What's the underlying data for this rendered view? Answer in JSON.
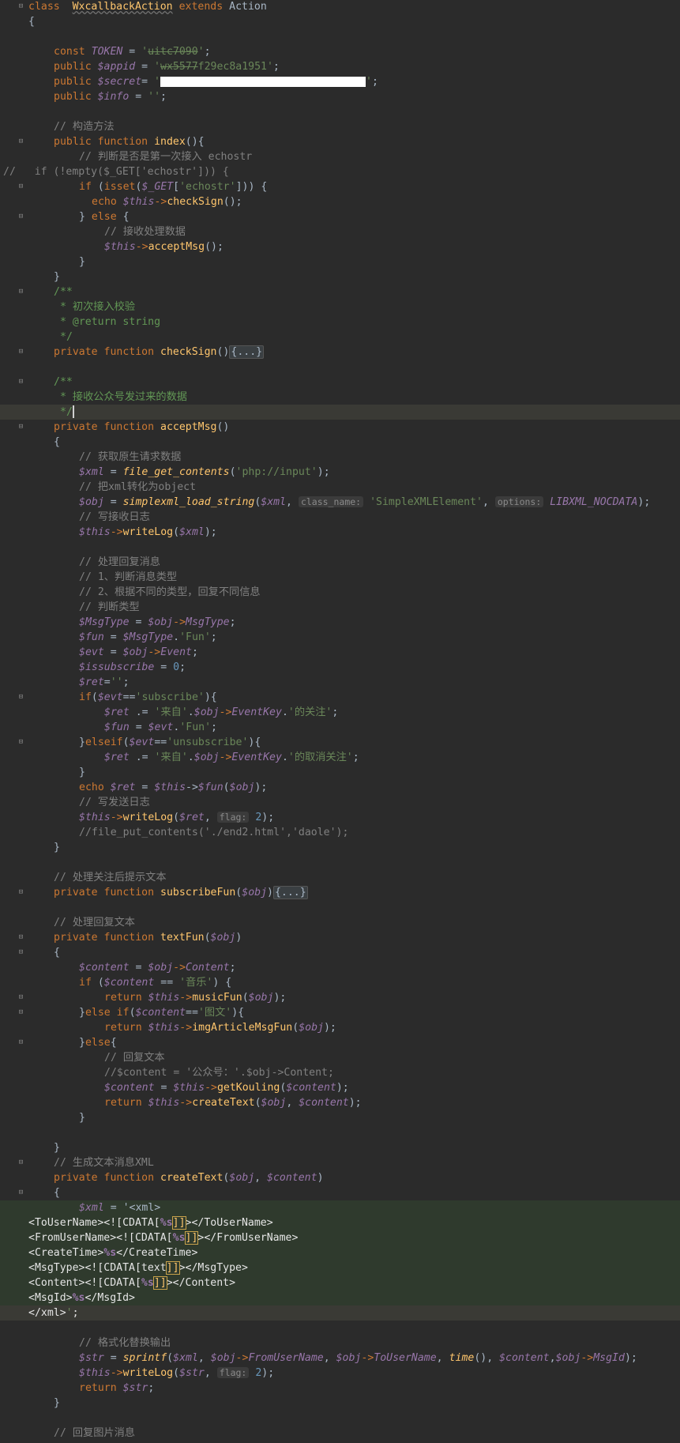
{
  "editor": {
    "lines": [
      "class WxcallbackAction extends Action",
      "{",
      "const TOKEN = 'uitc7090';",
      "public $appid = 'wx5577f29ec8a1951';",
      "public $secret= '';",
      "public $info = '';",
      "// 构造方法",
      "public function index(){",
      "// 判断是否是第一次接入 echostr",
      "//   if (!empty($_GET['echostr'])) {",
      "if (isset($_GET['echostr'])) {",
      "echo $this->checkSign();",
      "} else {",
      "// 接收处理数据",
      "$this->acceptMsg();",
      "}",
      "}",
      "/**",
      "* 初次接入校验",
      "* @return string",
      "*/",
      "private function checkSign(){...}",
      "/**",
      "* 接收公众号发过来的数据",
      "*/",
      "private function acceptMsg()",
      "{",
      "// 获取原生请求数据",
      "$xml = file_get_contents('php://input');",
      "// 把xml转化为object",
      "$obj = simplexml_load_string($xml, class_name: 'SimpleXMLElement', options: LIBXML_NOCDATA);",
      "// 写接收日志",
      "$this->writeLog($xml);",
      "// 处理回复消息",
      "// 1、判断消息类型",
      "// 2、根据不同的类型，回复不同信息",
      "// 判断类型",
      "$MsgType = $obj->MsgType;",
      "$fun = $MsgType.'Fun';",
      "$evt = $obj->Event;",
      "$issubscribe = 0;",
      "$ret='';",
      "if($evt=='subscribe'){",
      "$ret .= '来自'.$obj->EventKey.'的关注';",
      "$fun = $evt.'Fun';",
      "}elseif($evt=='unsubscribe'){",
      "$ret .= '来自'.$obj->EventKey.'的取消关注';",
      "}",
      "echo $ret = $this->$fun($obj);",
      "// 写发送日志",
      "$this->writeLog($ret, flag: 2);",
      "//file_put_contents('./end2.html','daole');",
      "}",
      "// 处理关注后提示文本",
      "private function subscribeFun($obj){...}",
      "// 处理回复文本",
      "private function textFun($obj)",
      "{",
      "$content = $obj->Content;",
      "if ($content == '音乐') {",
      "return $this->musicFun($obj);",
      "}else if($content=='图文'){",
      "return $this->imgArticleMsgFun($obj);",
      "}else{",
      "// 回复文本",
      "//$content = '公众号：'.$obj->Content;",
      "$content = $this->getKouling($content);",
      "return $this->createText($obj, $content);",
      "}",
      "}",
      "// 生成文本消息XML",
      "private function createText($obj, $content)",
      "{",
      "$xml = '<xml>",
      "<ToUserName><![CDATA[%s]]></ToUserName>",
      "<FromUserName><![CDATA[%s]]></FromUserName>",
      "<CreateTime>%s</CreateTime>",
      "<MsgType><![CDATA[text]]></MsgType>",
      "<Content><![CDATA[%s]]></Content>",
      "<MsgId>%s</MsgId>",
      "</xml>';",
      "// 格式化替换输出",
      "$str = sprintf($xml, $obj->FromUserName, $obj->ToUserName, time(), $content,$obj->MsgId);",
      "$this->writeLog($str, flag: 2);",
      "return $str;",
      "}",
      "// 回复图片消息"
    ]
  },
  "colors": {
    "background": "#2b2b2b",
    "keyword": "#cc7832",
    "variable": "#9876aa",
    "string": "#6a8759",
    "comment": "#808080",
    "function": "#ffc66d",
    "number": "#6897bb",
    "text": "#a9b7c6"
  }
}
